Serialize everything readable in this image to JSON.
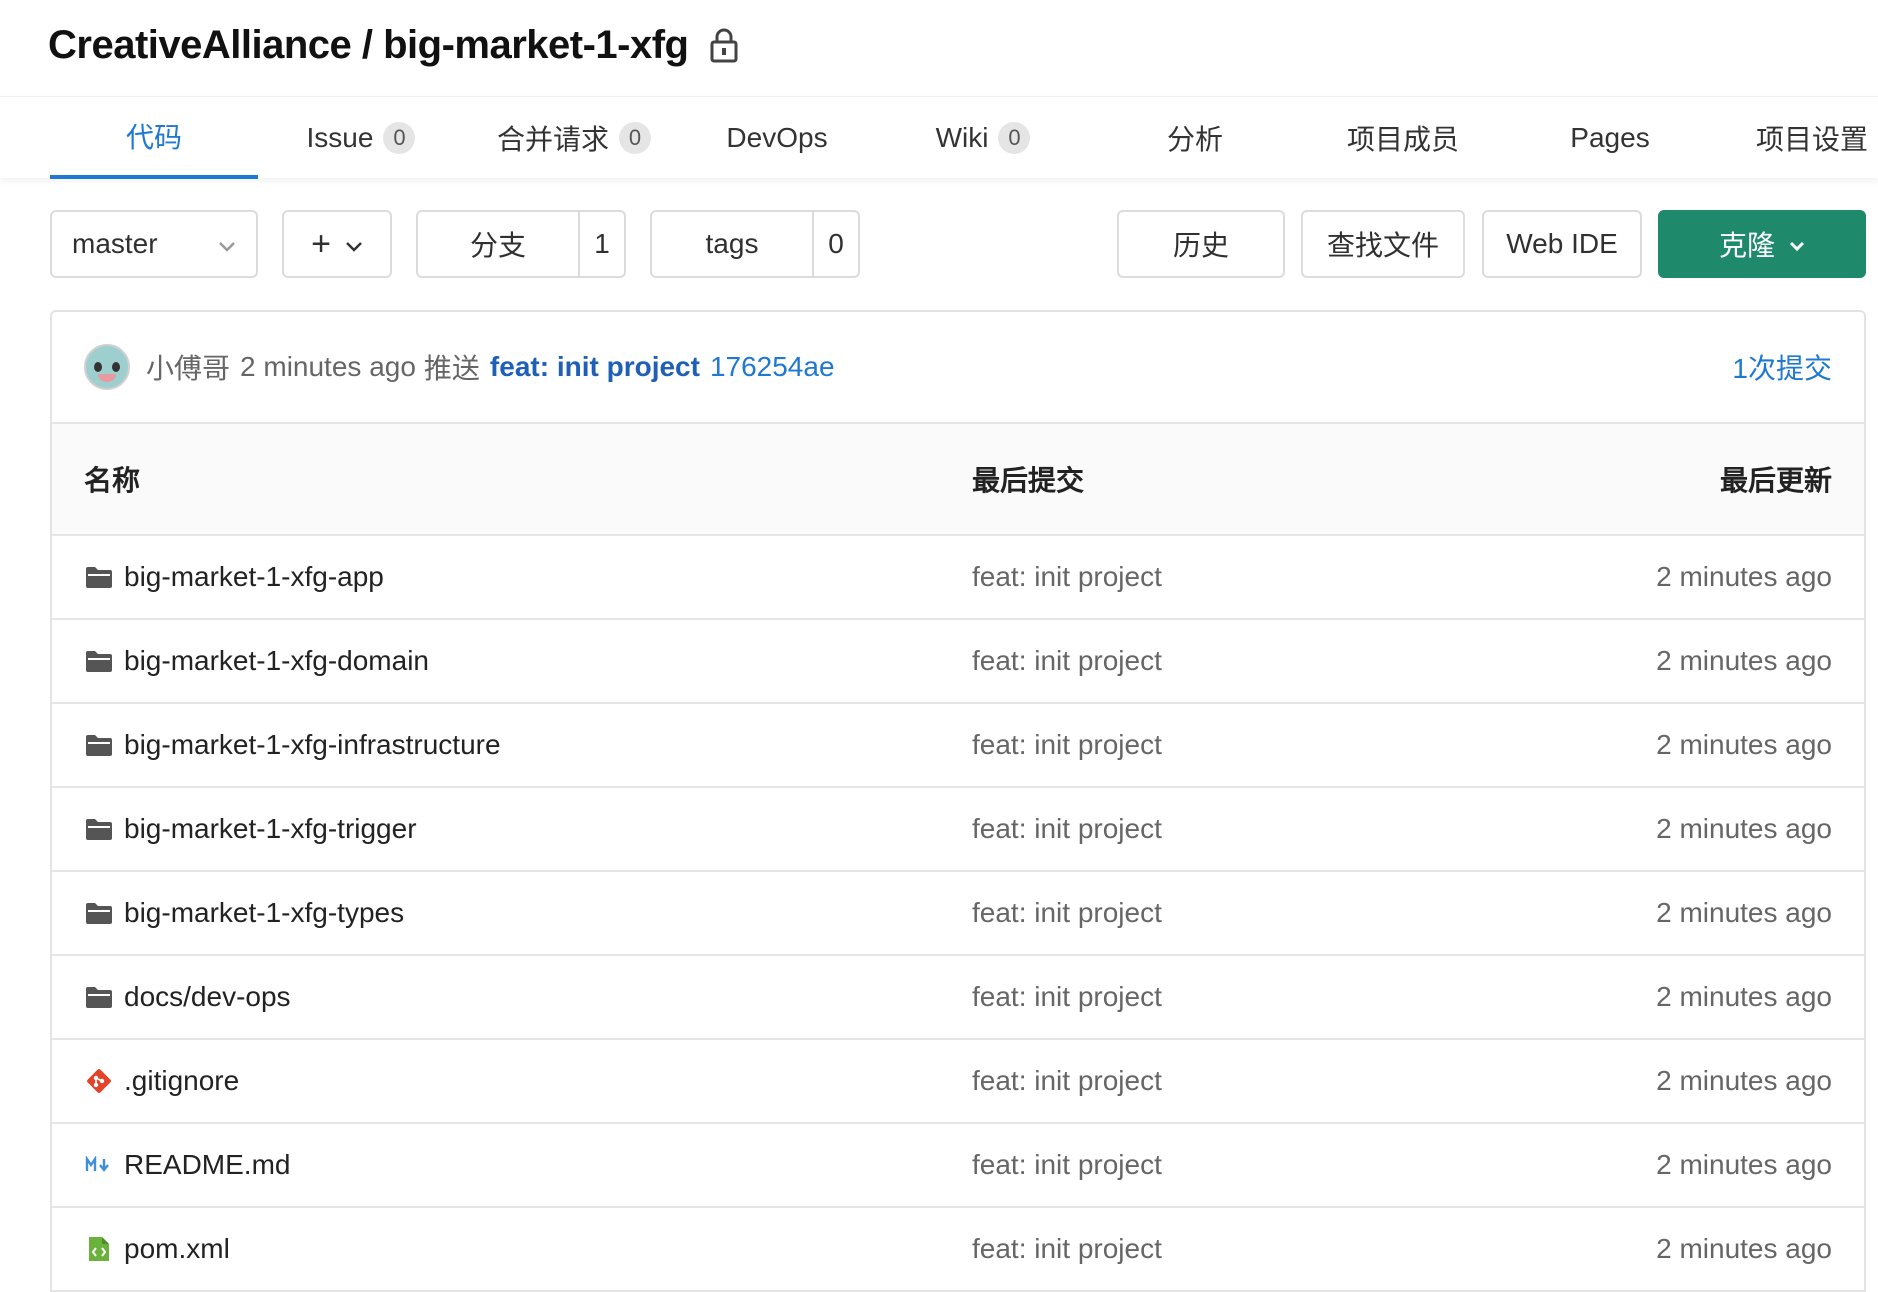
{
  "header": {
    "breadcrumb": "CreativeAlliance / big-market-1-xfg",
    "lock_icon": "lock-icon"
  },
  "tabs": [
    {
      "label": "代码",
      "count": null,
      "active": true
    },
    {
      "label": "Issue",
      "count": "0"
    },
    {
      "label": "合并请求",
      "count": "0"
    },
    {
      "label": "DevOps",
      "count": null
    },
    {
      "label": "Wiki",
      "count": "0"
    },
    {
      "label": "分析",
      "count": null
    },
    {
      "label": "项目成员",
      "count": null
    },
    {
      "label": "Pages",
      "count": null
    },
    {
      "label": "项目设置",
      "count": null
    }
  ],
  "toolbar": {
    "branch": "master",
    "plus": "+",
    "branches_label": "分支",
    "branches_count": "1",
    "tags_label": "tags",
    "tags_count": "0",
    "history": "历史",
    "find_file": "查找文件",
    "web_ide": "Web IDE",
    "clone": "克隆"
  },
  "last_commit": {
    "author": "小傅哥",
    "time": "2 minutes ago",
    "verb": "推送",
    "message": "feat: init project",
    "sha": "176254ae",
    "count_link": "1次提交"
  },
  "table": {
    "headers": {
      "name": "名称",
      "last_commit": "最后提交",
      "last_update": "最后更新"
    },
    "rows": [
      {
        "icon": "folder-icon",
        "name": "big-market-1-xfg-app",
        "commit": "feat: init project",
        "updated": "2 minutes ago"
      },
      {
        "icon": "folder-icon",
        "name": "big-market-1-xfg-domain",
        "commit": "feat: init project",
        "updated": "2 minutes ago"
      },
      {
        "icon": "folder-icon",
        "name": "big-market-1-xfg-infrastructure",
        "commit": "feat: init project",
        "updated": "2 minutes ago"
      },
      {
        "icon": "folder-icon",
        "name": "big-market-1-xfg-trigger",
        "commit": "feat: init project",
        "updated": "2 minutes ago"
      },
      {
        "icon": "folder-icon",
        "name": "big-market-1-xfg-types",
        "commit": "feat: init project",
        "updated": "2 minutes ago"
      },
      {
        "icon": "folder-icon",
        "name": "docs/dev-ops",
        "commit": "feat: init project",
        "updated": "2 minutes ago"
      },
      {
        "icon": "git-icon",
        "name": ".gitignore",
        "commit": "feat: init project",
        "updated": "2 minutes ago"
      },
      {
        "icon": "markdown-icon",
        "name": "README.md",
        "commit": "feat: init project",
        "updated": "2 minutes ago"
      },
      {
        "icon": "xml-file-icon",
        "name": "pom.xml",
        "commit": "feat: init project",
        "updated": "2 minutes ago"
      }
    ]
  },
  "colors": {
    "accent": "#1f78d1",
    "clone_button": "#1e8a6b",
    "git_icon": "#e24329",
    "xml_icon": "#6ab23c"
  }
}
